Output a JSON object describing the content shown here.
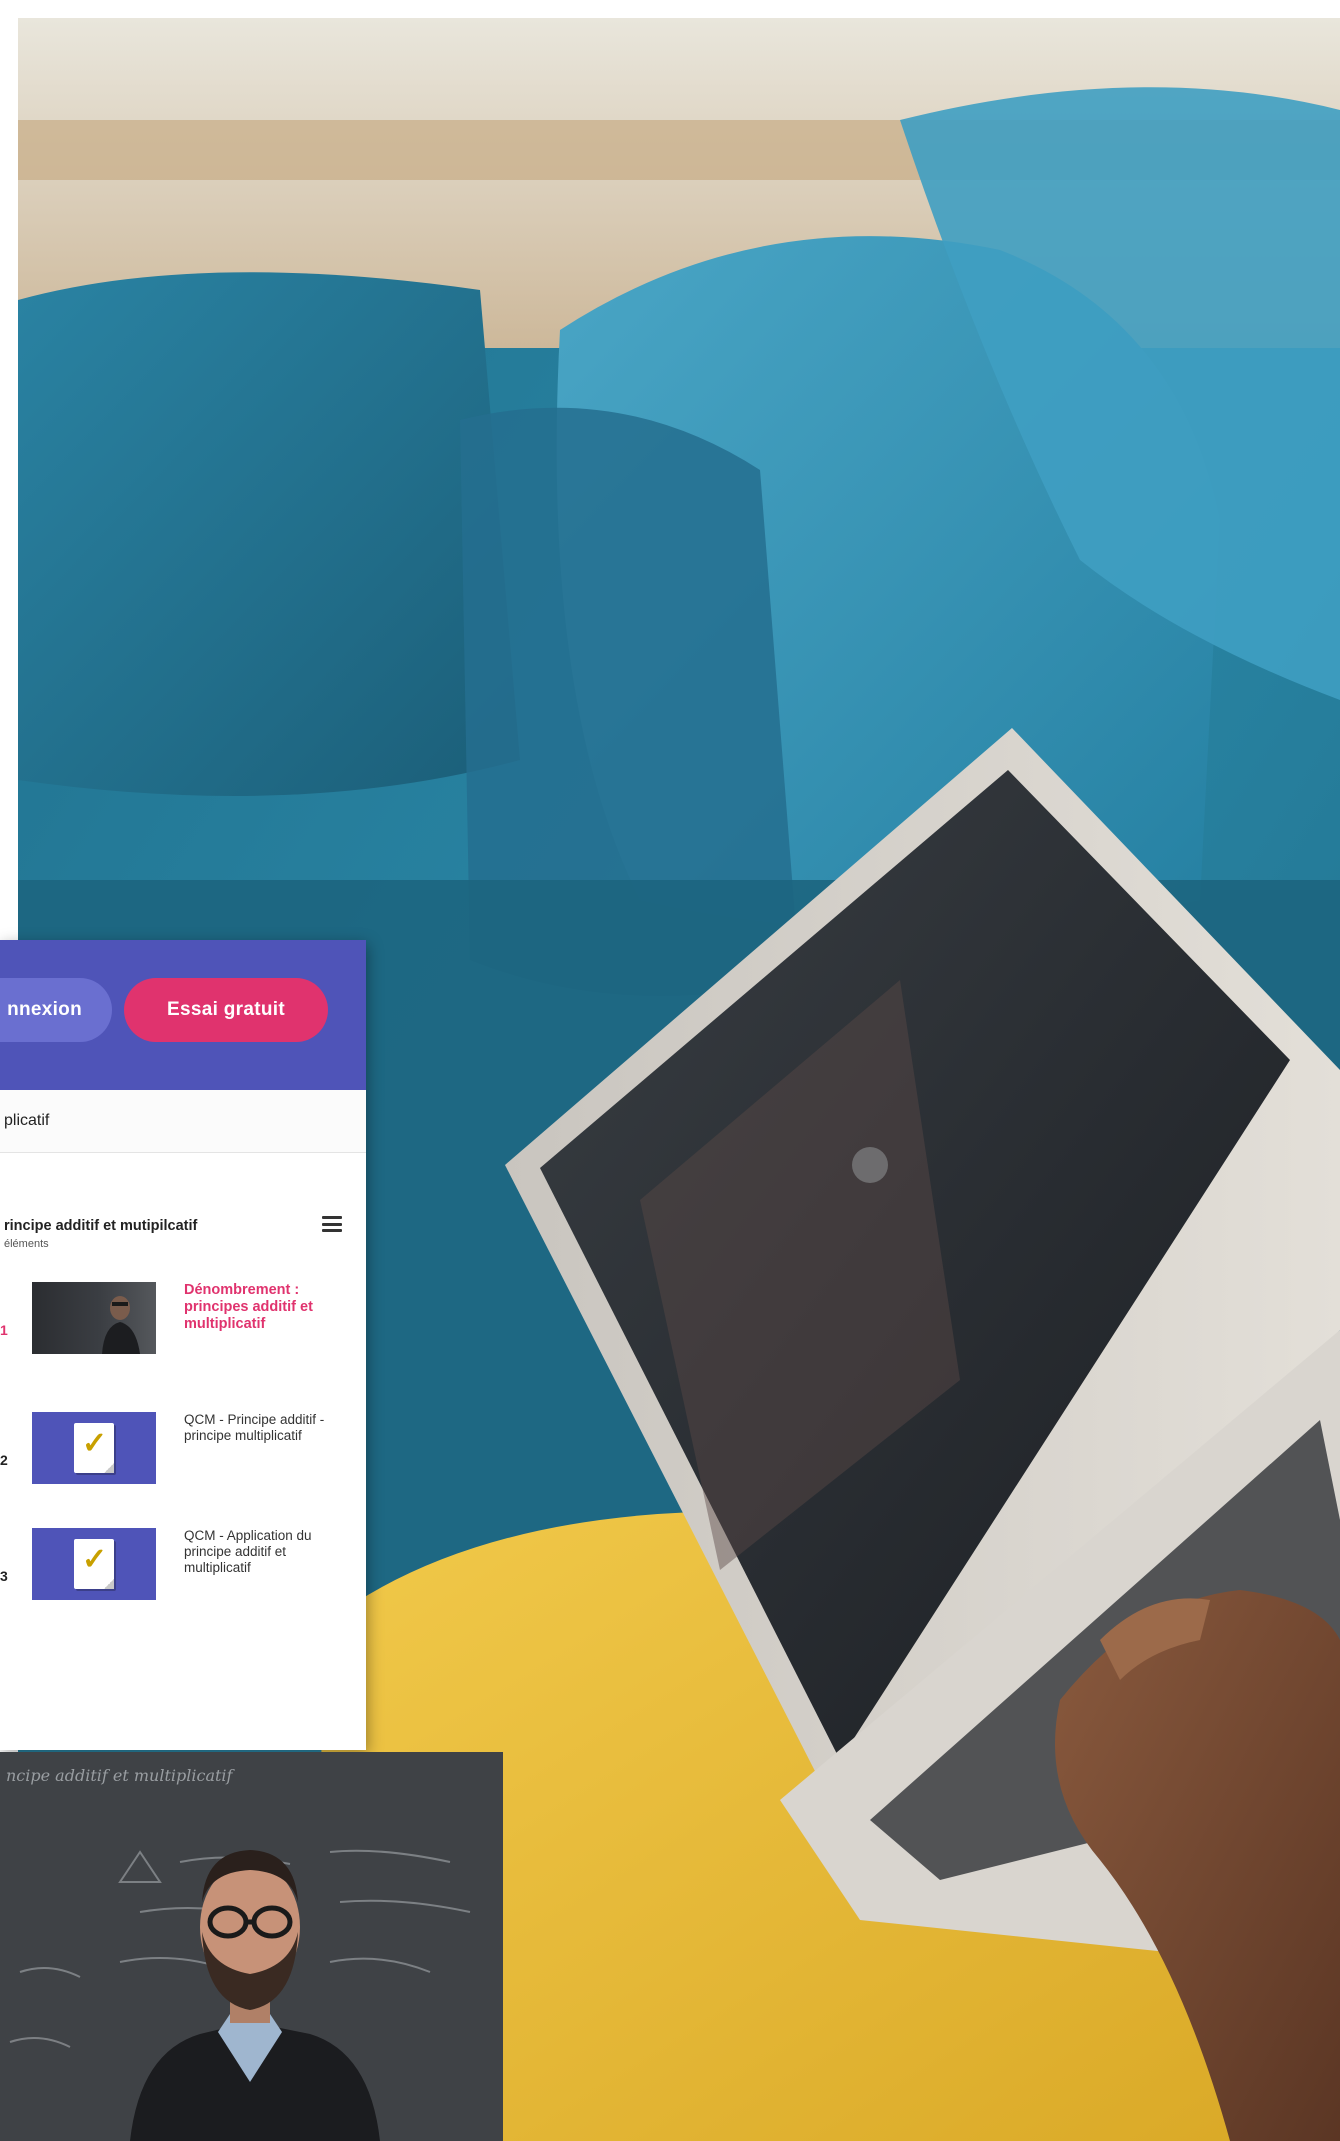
{
  "panel": {
    "login_label": "nnexion",
    "trial_label": "Essai gratuit",
    "breadcrumb": "plicatif",
    "chapter_title": "rincipe additif et mutipilcatif",
    "chapter_subtitle": "éléments"
  },
  "items": [
    {
      "number": "1",
      "title": "Dénombrement : principes additif et multiplicatif",
      "type": "video",
      "active": true
    },
    {
      "number": "2",
      "title": "QCM - Principe additif - principe multiplicatif",
      "type": "quiz",
      "active": false
    },
    {
      "number": "3",
      "title": "QCM - Application du principe additif et multiplicatif",
      "type": "quiz",
      "active": false
    }
  ],
  "video": {
    "caption": "ncipe additif et multiplicatif"
  },
  "colors": {
    "header": "#4f54b8",
    "trial_button": "#e0336e",
    "login_button": "#6a6fd0",
    "active_item": "#e0336e"
  },
  "icons": [
    "menu-icon",
    "checkmark-icon"
  ]
}
